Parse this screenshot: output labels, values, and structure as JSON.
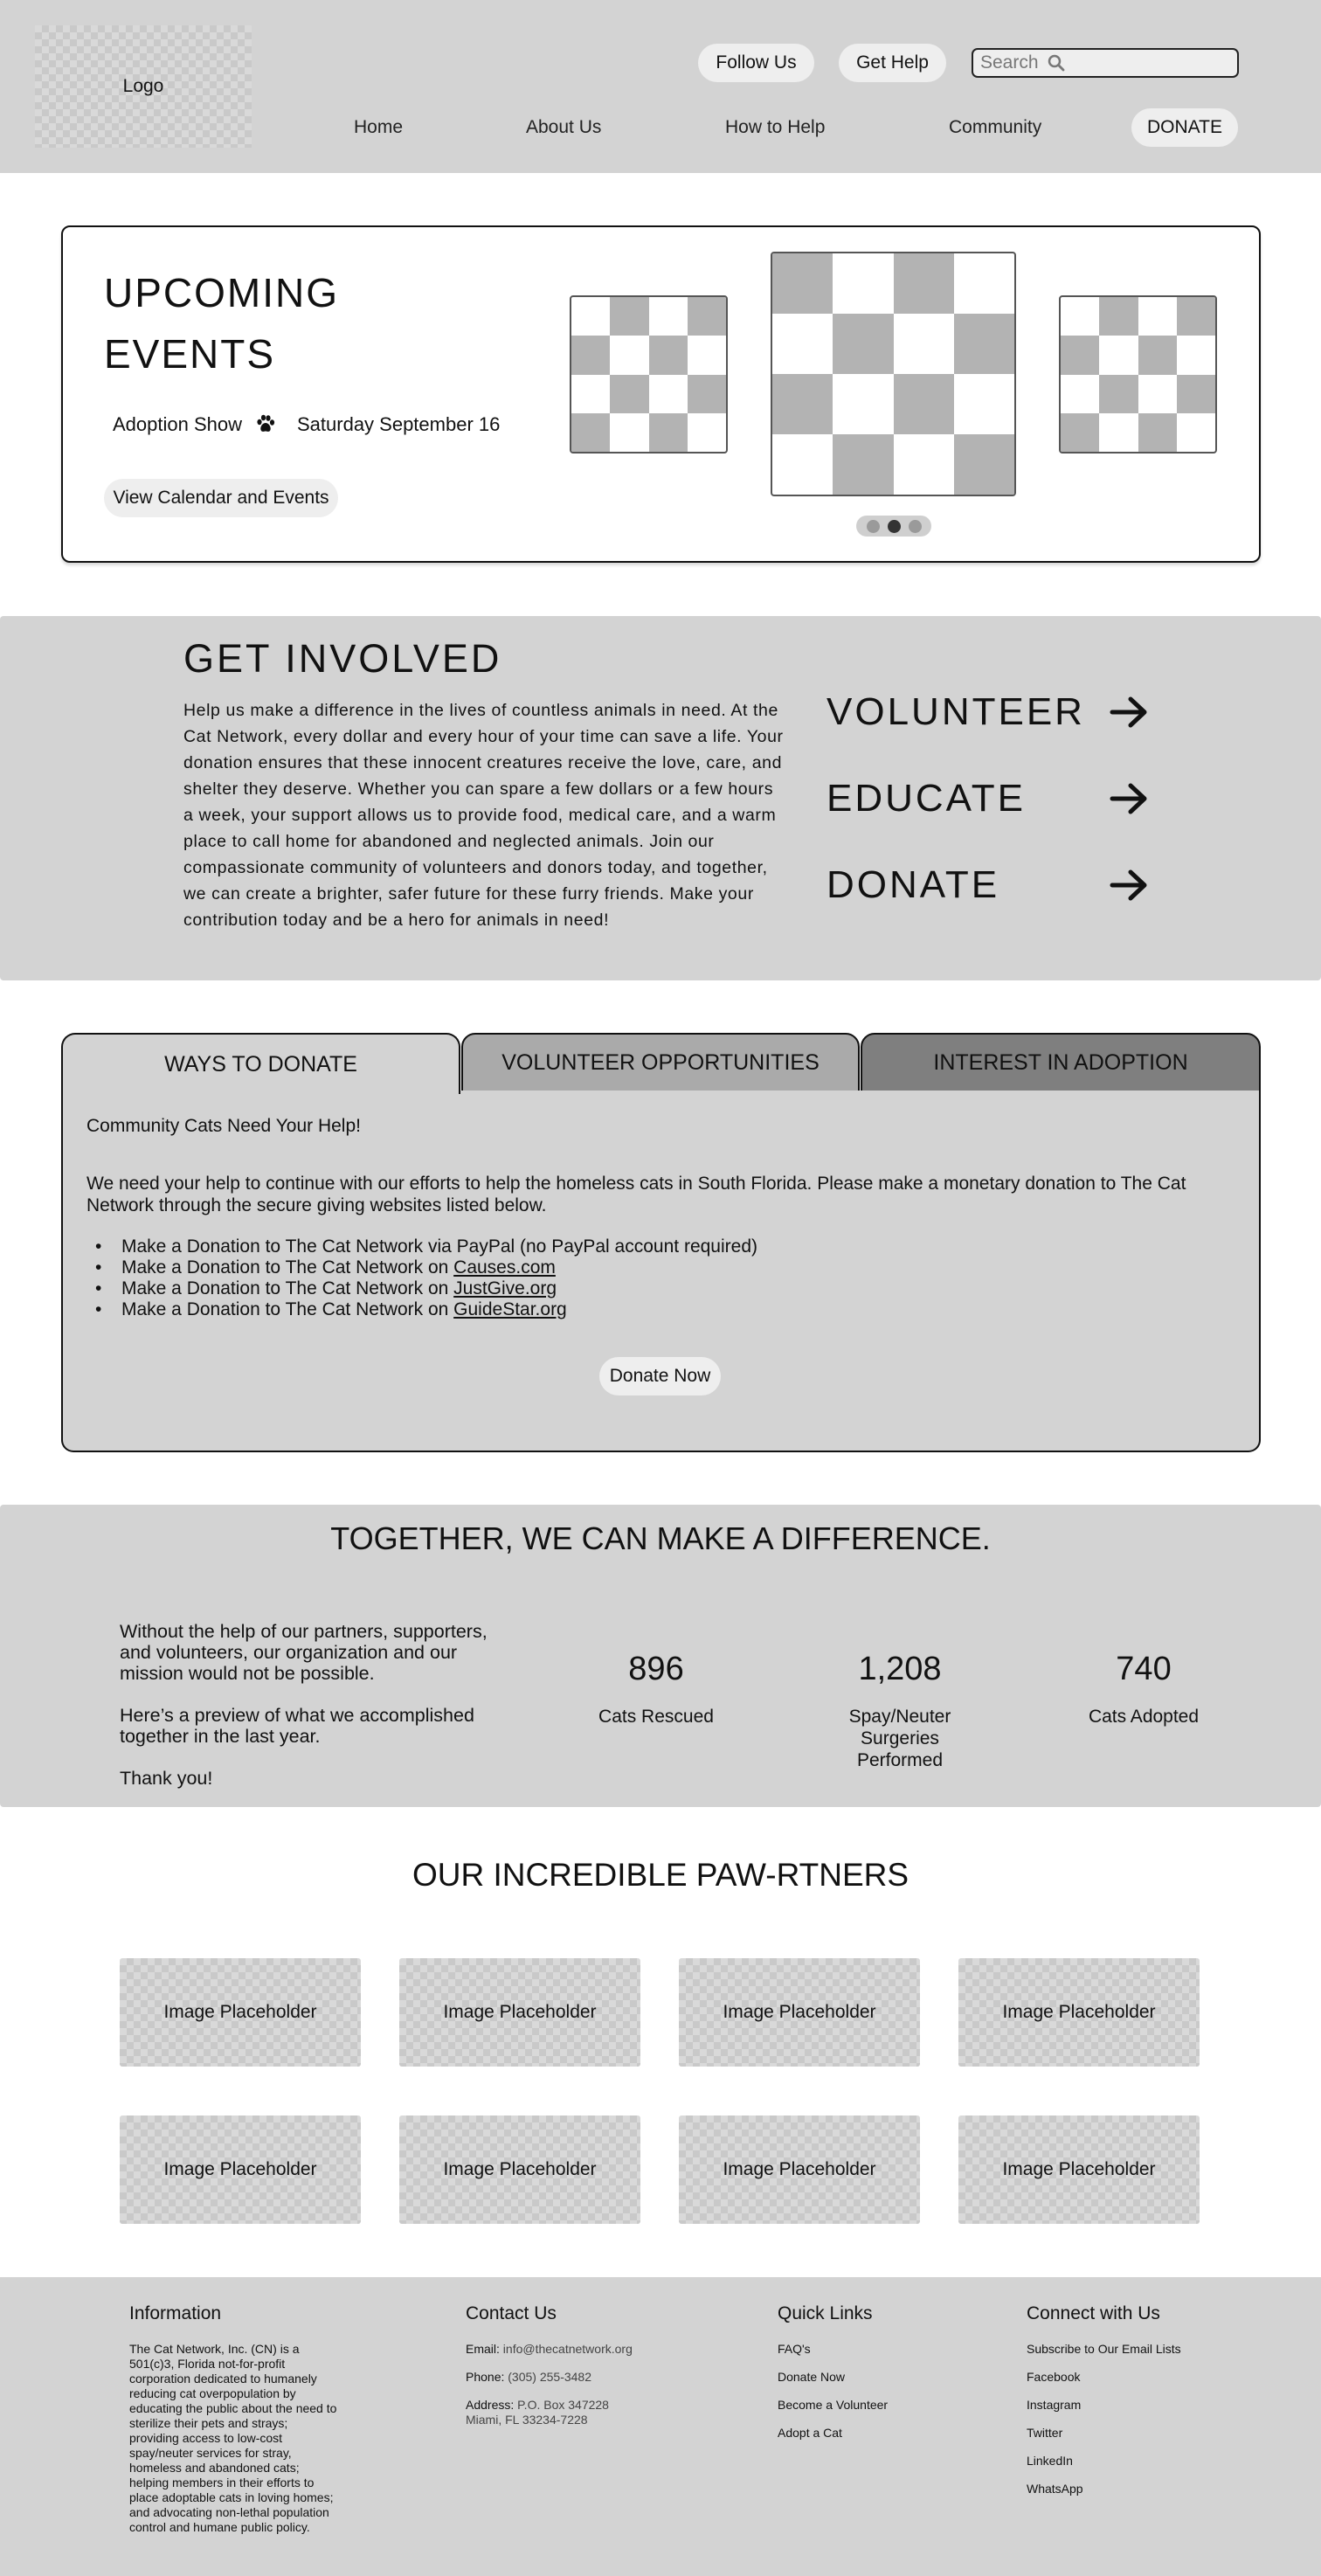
{
  "header": {
    "logo": "Logo",
    "follow_us": "Follow Us",
    "get_help": "Get Help",
    "search_placeholder": "Search",
    "nav": [
      "Home",
      "About Us",
      "How to Help",
      "Community",
      "DONATE"
    ]
  },
  "events": {
    "title": "UPCOMING EVENTS",
    "event_name": "Adoption Show",
    "event_icon": "paw-icon",
    "event_date": "Saturday September 16",
    "button": "View Calendar and Events",
    "carousel_active_index": 1,
    "carousel_count": 3
  },
  "involved": {
    "title": "GET INVOLVED",
    "text": "Help us make a difference in the lives of countless animals in need. At the Cat Network, every dollar and every hour of your time can save a life. Your donation ensures that these innocent creatures receive the love, care, and shelter they deserve. Whether you can spare a few dollars or a few hours a week, your support allows us to provide food, medical care, and a warm place to call home for abandoned and neglected animals. Join our compassionate community of volunteers and donors today, and together, we can create a brighter, safer future for these furry friends. Make your contribution today and be a hero for animals in need!",
    "ctas": [
      "VOLUNTEER",
      "EDUCATE",
      "DONATE"
    ]
  },
  "tabs": {
    "labels": [
      "WAYS TO DONATE",
      "VOLUNTEER OPPORTUNITIES",
      "INTEREST IN ADOPTION"
    ],
    "active": 0,
    "panel": {
      "heading": "Community Cats Need Your Help!",
      "text": "We need your help to continue with our efforts to help the homeless cats in South Florida. Please make a monetary donation to The Cat Network through the secure giving websites listed below.",
      "items": [
        {
          "prefix": "Make a Donation to The Cat Network via PayPal (no PayPal account required)",
          "link": ""
        },
        {
          "prefix": "Make a Donation to The Cat Network on ",
          "link": "Causes.com"
        },
        {
          "prefix": "Make a Donation to The Cat Network on ",
          "link": "JustGive.org"
        },
        {
          "prefix": "Make a Donation to The Cat Network on ",
          "link": "GuideStar.org"
        }
      ],
      "button": "Donate Now"
    }
  },
  "difference": {
    "title": "TOGETHER, WE CAN MAKE A DIFFERENCE.",
    "para1": "Without the help of our partners, supporters, and volunteers, our organization and our mission  would not be possible.",
    "para2": "Here’s a preview of what we accomplished together  in the last year.",
    "para3": "Thank you!",
    "stats": [
      {
        "value": "896",
        "label": "Cats Rescued"
      },
      {
        "value": "1,208",
        "label": "Spay/Neuter Surgeries Performed"
      },
      {
        "value": "740",
        "label": "Cats Adopted"
      }
    ]
  },
  "partners": {
    "title": "OUR INCREDIBLE PAW-RTNERS",
    "items": [
      "Image Placeholder",
      "Image Placeholder",
      "Image Placeholder",
      "Image Placeholder",
      "Image Placeholder",
      "Image Placeholder",
      "Image Placeholder",
      "Image Placeholder"
    ]
  },
  "footer": {
    "info_title": "Information",
    "info_text": "The Cat Network, Inc. (CN) is a 501(c)3,  Florida not-for-profit corporation dedicated to humanely reducing cat overpopulation by educating the public about the need to sterilize their pets and strays; providing access to low-cost spay/neuter services for stray, homeless and abandoned cats; helping members in their efforts to place adoptable cats in loving homes; and advocating non-lethal population control and humane public policy.",
    "contact_title": "Contact Us",
    "email_label": "Email:",
    "email": "info@thecatnetwork.org",
    "phone_label": "Phone:",
    "phone": "(305) 255-3482",
    "address_label": "Address:",
    "address_line1": "P.O. Box 347228",
    "address_line2": "Miami, FL 33234-7228",
    "links_title": "Quick Links",
    "links": [
      "FAQ's",
      "Donate Now",
      "Become a Volunteer",
      "Adopt a Cat"
    ],
    "connect_title": "Connect with Us",
    "connect": [
      "Subscribe to Our Email Lists",
      "Facebook",
      "Instagram",
      "Twitter",
      "LinkedIn",
      "WhatsApp"
    ]
  }
}
